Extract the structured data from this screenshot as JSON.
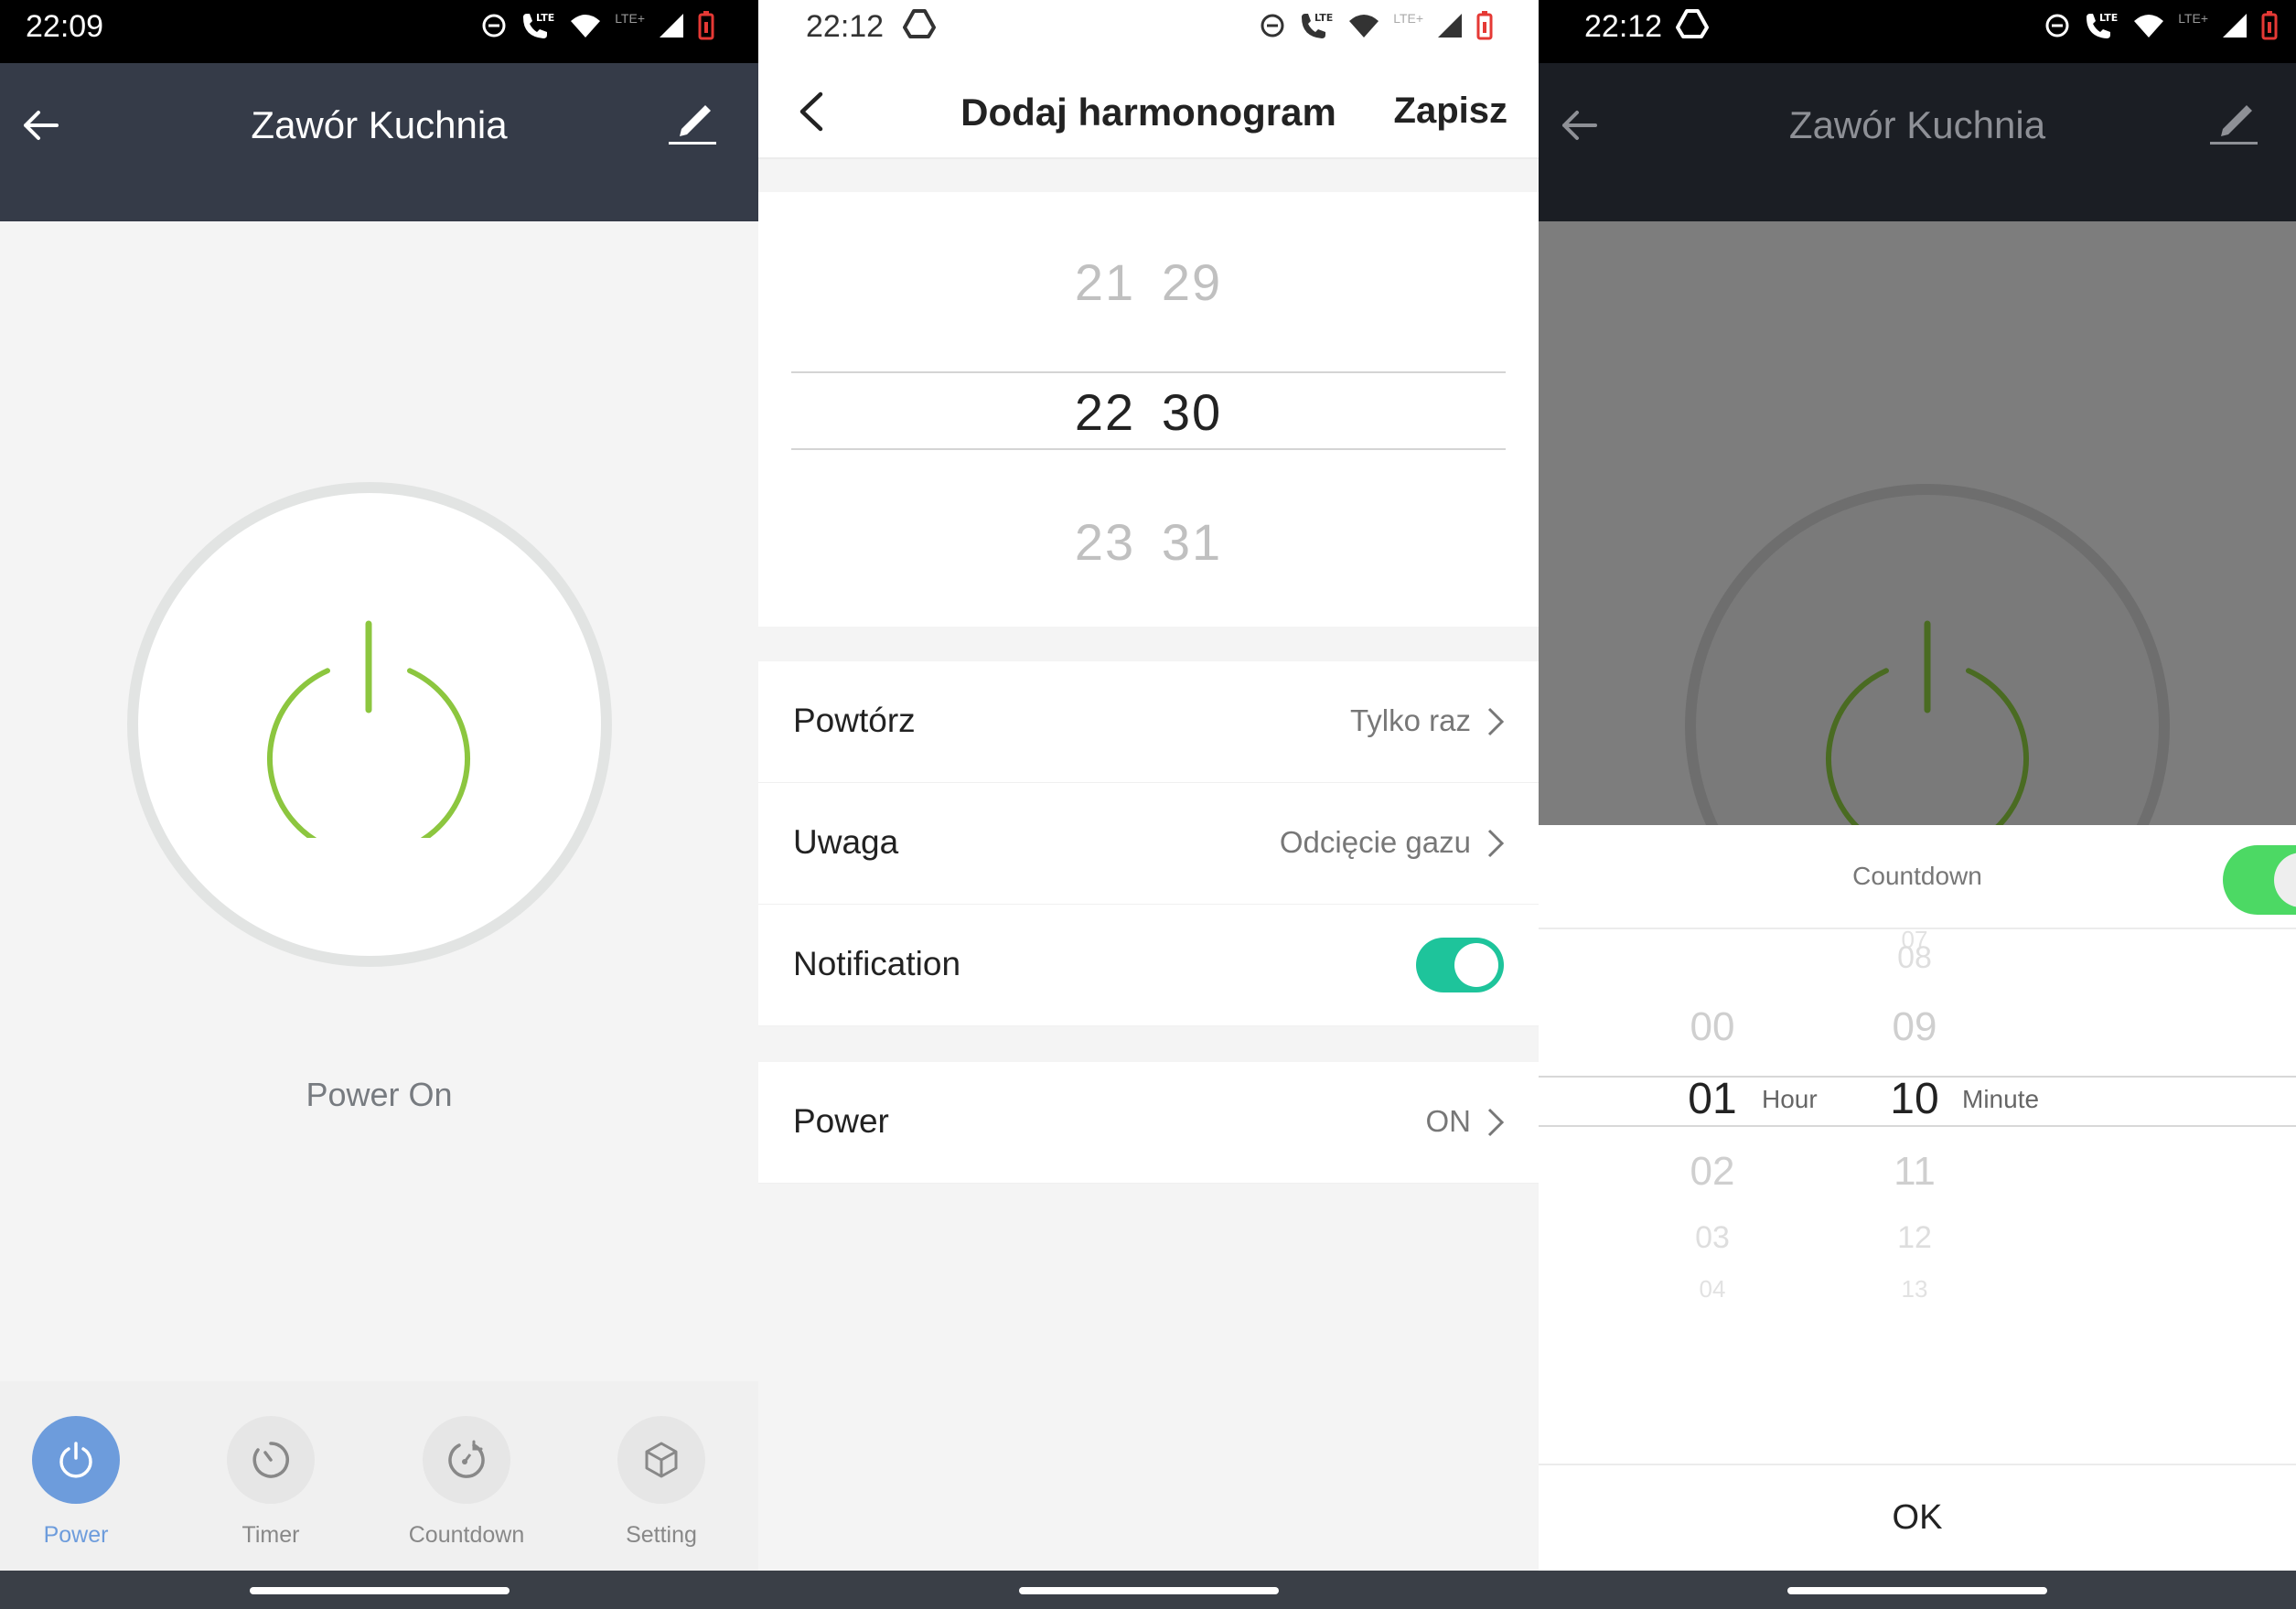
{
  "screen1": {
    "status": {
      "time": "22:09"
    },
    "appbar": {
      "title": "Zawór Kuchnia"
    },
    "power_state_label": "Power On",
    "tabs": [
      {
        "label": "Power",
        "icon": "power-icon",
        "active": true
      },
      {
        "label": "Timer",
        "icon": "timer-icon",
        "active": false
      },
      {
        "label": "Countdown",
        "icon": "countdown-icon",
        "active": false
      },
      {
        "label": "Setting",
        "icon": "setting-cube-icon",
        "active": false
      }
    ],
    "colors": {
      "accent": "#8cc63f",
      "tab_active": "#6d9cdc",
      "appbar": "#353b48"
    }
  },
  "screen2": {
    "status": {
      "time": "22:12"
    },
    "header": {
      "title": "Dodaj harmonogram",
      "save_label": "Zapisz"
    },
    "picker": {
      "prev": {
        "hour": "21",
        "minute": "29"
      },
      "selected": {
        "hour": "22",
        "minute": "30"
      },
      "next": {
        "hour": "23",
        "minute": "31"
      }
    },
    "rows": {
      "repeat": {
        "label": "Powtórz",
        "value": "Tylko raz"
      },
      "note": {
        "label": "Uwaga",
        "value": "Odcięcie gazu"
      },
      "notification": {
        "label": "Notification",
        "enabled": true
      },
      "power": {
        "label": "Power",
        "value": "ON"
      }
    },
    "colors": {
      "toggle_on": "#1ec49b"
    }
  },
  "screen3": {
    "status": {
      "time": "22:12"
    },
    "appbar": {
      "title": "Zawór Kuchnia"
    },
    "sheet": {
      "title": "Countdown",
      "enabled": true,
      "hours": {
        "tiny_above": "",
        "above": "00",
        "selected": "01",
        "below1": "02",
        "below2": "03",
        "tiny_below": "04",
        "unit": "Hour"
      },
      "minutes": {
        "tiny_above": "07",
        "above2": "08",
        "above": "09",
        "selected": "10",
        "below1": "11",
        "below2": "12",
        "tiny_below": "13",
        "unit": "Minute"
      },
      "ok_label": "OK"
    },
    "colors": {
      "toggle_on": "#4cd964"
    }
  }
}
